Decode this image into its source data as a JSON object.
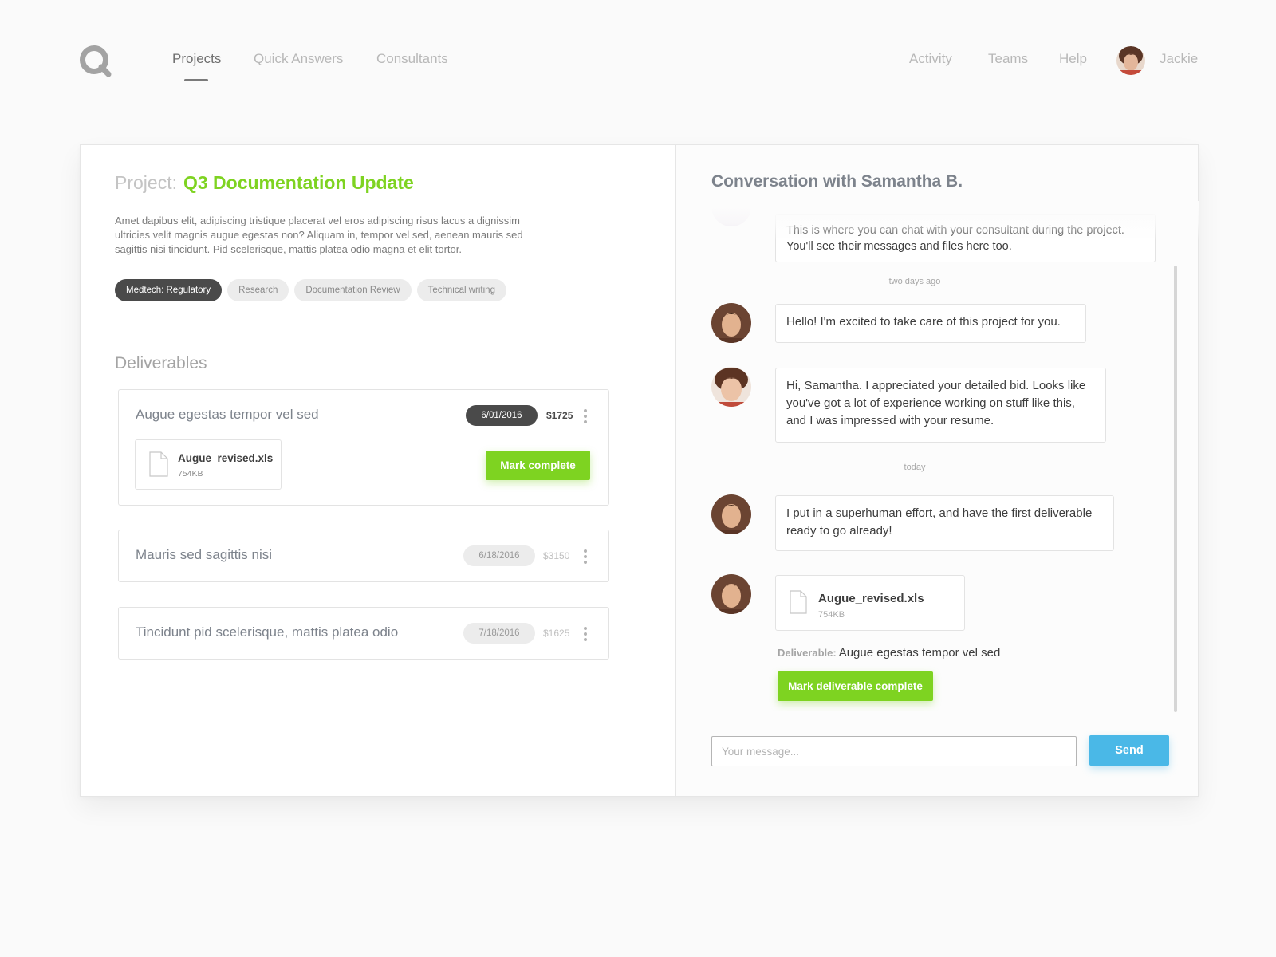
{
  "nav": {
    "logo_icon": "q-logo-icon",
    "left_links": [
      {
        "label": "Projects",
        "active": true
      },
      {
        "label": "Quick Answers",
        "active": false
      },
      {
        "label": "Consultants",
        "active": false
      }
    ],
    "right_links": [
      {
        "label": "Activity"
      },
      {
        "label": "Teams"
      },
      {
        "label": "Help"
      }
    ],
    "user_name": "Jackie"
  },
  "project": {
    "prefix": "Project:",
    "name": "Q3 Documentation Update",
    "description": "Amet dapibus elit, adipiscing tristique placerat vel eros adipiscing risus lacus a dignissim ultricies velit magnis augue egestas non? Aliquam in, tempor vel sed, aenean mauris sed sagittis nisi tincidunt. Pid scelerisque, mattis platea odio magna et elit tortor.",
    "tags": [
      {
        "label": "Medtech: Regulatory",
        "active": true
      },
      {
        "label": "Research",
        "active": false
      },
      {
        "label": "Documentation Review",
        "active": false
      },
      {
        "label": "Technical writing",
        "active": false
      }
    ]
  },
  "deliverables": {
    "title": "Deliverables",
    "items": [
      {
        "title": "Augue egestas tempor vel sed",
        "date": "6/01/2016",
        "price": "$1725",
        "file": {
          "name": "Augue_revised.xls",
          "size": "754KB"
        },
        "action": "Mark complete"
      },
      {
        "title": "Mauris sed sagittis nisi",
        "date": "6/18/2016",
        "price": "$3150"
      },
      {
        "title": "Tincidunt pid scelerisque, mattis platea odio",
        "date": "7/18/2016",
        "price": "$1625"
      }
    ]
  },
  "conversation": {
    "title": "Conversation with Samantha B.",
    "intro": "This is where you can chat with your consultant during the project. You'll see their messages and files here too.",
    "stamp_1": "two days ago",
    "stamp_2": "today",
    "messages": [
      {
        "text": "Hello! I'm excited to take care of this project for you."
      },
      {
        "text": "Hi, Samantha. I appreciated your detailed bid. Looks like you've got a lot of experience working on stuff like this, and I was impressed with your resume."
      },
      {
        "text": "I put in a superhuman effort, and have the first deliverable ready to go already!"
      }
    ],
    "file": {
      "name": "Augue_revised.xls",
      "size": "754KB"
    },
    "deliverable_label": "Deliverable:",
    "deliverable_name": "Augue egestas tempor vel sed",
    "mark_button": "Mark deliverable complete",
    "input_placeholder": "Your message...",
    "send_label": "Send"
  },
  "colors": {
    "accent_green": "#7ed321",
    "send_blue": "#4ab8e7",
    "dark_pill": "#4a4a4a"
  }
}
